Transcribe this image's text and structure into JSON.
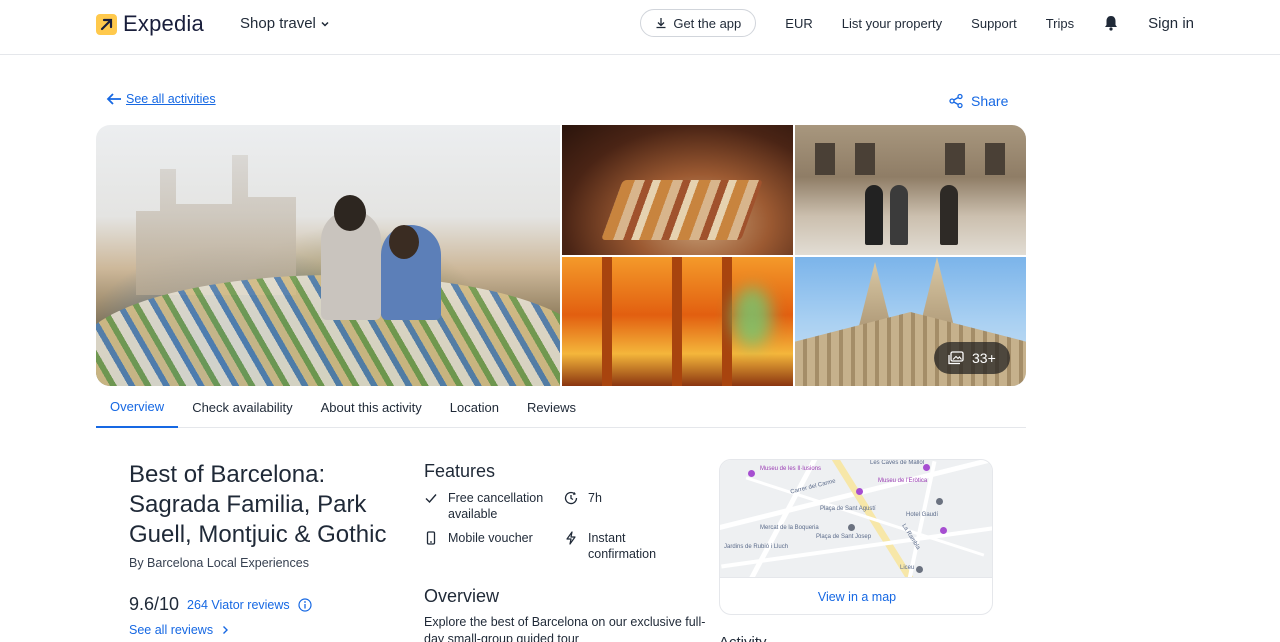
{
  "header": {
    "logo_text": "Expedia",
    "shop_travel": "Shop travel",
    "get_app": "Get the app",
    "currency": "EUR",
    "list_property": "List your property",
    "support": "Support",
    "trips": "Trips",
    "sign_in": "Sign in"
  },
  "subbar": {
    "see_all": "See all activities",
    "share": "Share"
  },
  "gallery": {
    "more_count": "33+"
  },
  "tabs": [
    "Overview",
    "Check availability",
    "About this activity",
    "Location",
    "Reviews"
  ],
  "activity": {
    "title": "Best of Barcelona: Sagrada Familia, Park Guell, Montjuic & Gothic",
    "provider": "By Barcelona Local Experiences",
    "score": "9.6/10",
    "reviews": "264 Viator reviews",
    "see_reviews": "See all reviews"
  },
  "features": {
    "heading": "Features",
    "items": [
      {
        "label": "Free cancellation available",
        "icon": "check-icon"
      },
      {
        "label": "7h",
        "icon": "clock-icon"
      },
      {
        "label": "Mobile voucher",
        "icon": "phone-icon"
      },
      {
        "label": "Instant confirmation",
        "icon": "lightning-icon"
      }
    ]
  },
  "overview": {
    "heading": "Overview",
    "text": "Explore the best of Barcelona on our exclusive full-day small-group guided tour"
  },
  "map": {
    "view_label": "View in a map",
    "labels": [
      "Museu de les Il·lusions",
      "Les Caves de Mallol",
      "Carrer del Carme",
      "Plaça de Sant Agustí",
      "Museu de l'Eròtica",
      "Mercat de la Boqueria",
      "Hotel Gaudí",
      "Plaça de Sant Josep",
      "Liceu",
      "Jardins de Rubió i Lluch",
      "La Rambla"
    ]
  },
  "activities_heading": "Activity location",
  "colors": {
    "accent": "#1668e3",
    "logo_yellow": "#ffc94c",
    "text": "#1f2937"
  }
}
